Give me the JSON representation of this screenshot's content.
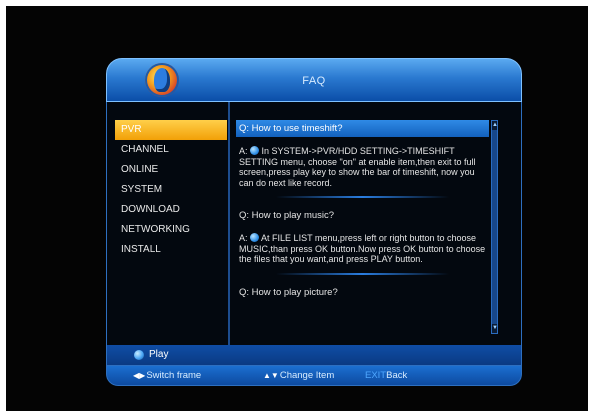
{
  "header": {
    "title": "FAQ"
  },
  "menu": {
    "items": [
      {
        "label": "PVR",
        "selected": true
      },
      {
        "label": "CHANNEL"
      },
      {
        "label": "ONLINE"
      },
      {
        "label": "SYSTEM"
      },
      {
        "label": "DOWNLOAD"
      },
      {
        "label": "NETWORKING"
      },
      {
        "label": "INSTALL"
      }
    ]
  },
  "faq": {
    "q1": "Q: How to use timeshift?",
    "a1": "In SYSTEM->PVR/HDD SETTING->TIMESHIFT SETTING menu, choose \"on\" at enable item,then exit to full screen,press play key to show the bar of timeshift, now you can do next like record.",
    "q2": "Q: How to play music?",
    "a2": "At FILE LIST menu,press left or right button to choose MUSIC,than press OK button.Now press OK button to choose the files that you want,and press PLAY button.",
    "q3": "Q: How to play picture?",
    "answer_prefix": "A:"
  },
  "play_bar": {
    "label": "Play"
  },
  "hints": {
    "switch_frame": "Switch frame",
    "change_item": "Change Item",
    "exit_key": "EXIT",
    "back": "Back"
  },
  "colors": {
    "accent": "#2f8ae6",
    "selected_menu": "#f2a007",
    "frame": "#1b6fd0"
  }
}
